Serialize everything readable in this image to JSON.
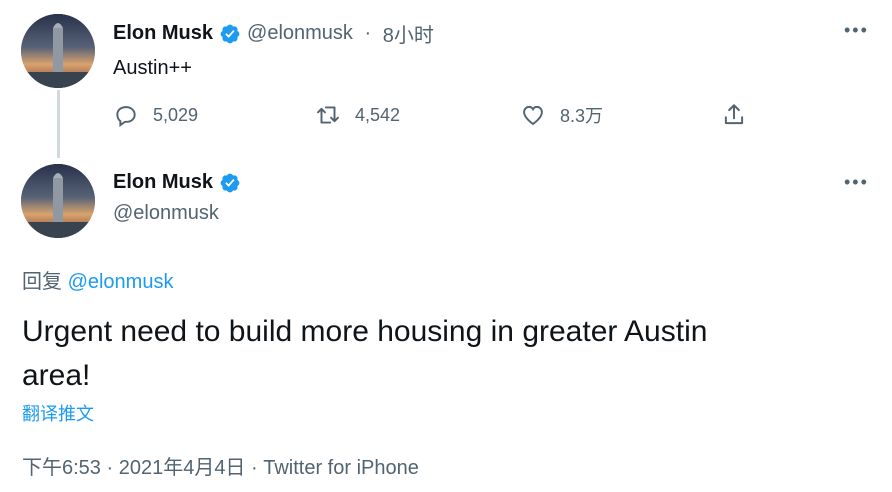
{
  "parent_tweet": {
    "author_name": "Elon Musk",
    "handle": "@elonmusk",
    "separator": " · ",
    "time": "8小时",
    "text": "Austin++",
    "replies": "5,029",
    "retweets": "4,542",
    "likes": "8.3万"
  },
  "main_tweet": {
    "author_name": "Elon Musk",
    "handle": "@elonmusk",
    "reply_prefix": "回复 ",
    "reply_to": "@elonmusk",
    "text_line1": "Urgent need to build more housing in greater Austin",
    "text_line2": "area!",
    "translate": "翻译推文",
    "meta_time": "下午6:53 · 2021年4月4日 · ",
    "source": "Twitter for iPhone"
  },
  "colors": {
    "accent": "#1d9bf0",
    "muted": "#536471",
    "text": "#0f1419",
    "thread_line": "#cfd9de"
  },
  "icons": [
    "verified-badge-icon",
    "more-icon",
    "reply-icon",
    "retweet-icon",
    "like-icon",
    "share-icon"
  ]
}
